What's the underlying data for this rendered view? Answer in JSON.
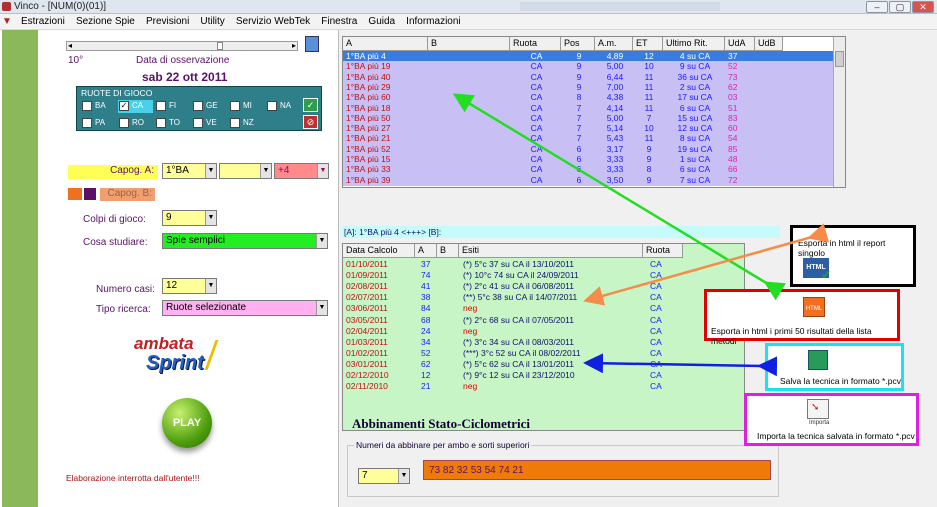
{
  "window": {
    "title": "Vinco - [NUM(0)(01)]",
    "min": "–",
    "max": "▢",
    "close": "✕"
  },
  "menu": [
    "Estrazioni",
    "Sezione Spie",
    "Previsioni",
    "Utility",
    "Servizio WebTek",
    "Finestra",
    "Guida",
    "Informazioni"
  ],
  "left": {
    "num": "10°",
    "obs_label": "Data di osservazione",
    "obs_date": "sab 22 ott 2011",
    "ruote_title": "RUOTE DI GIOCO",
    "ruote_row1": [
      "BA",
      "CA",
      "FI",
      "GE",
      "MI",
      "NA"
    ],
    "ruote_row2": [
      "PA",
      "RO",
      "TO",
      "VE",
      "NZ"
    ],
    "capog_a_label": "Capog. A:",
    "capog_a_val": "1°BA",
    "capog_a_mod": "+4",
    "capog_b_label": "Capog. B:",
    "colpi_label": "Colpi di gioco:",
    "colpi_val": "9",
    "studiare_label": "Cosa studiare:",
    "studiare_val": "Spie semplici",
    "casi_label": "Numero casi:",
    "casi_val": "12",
    "tipo_label": "Tipo ricerca:",
    "tipo_val": "Ruote selezionate",
    "logo1": "ambata",
    "logo2": "Sprint",
    "play": "PLAY",
    "status": "Elaborazione interrotta dall'utente!!!"
  },
  "grid1": {
    "headers": [
      "A",
      "B",
      "Ruota",
      "Pos",
      "A.m.",
      "ET",
      "Ultimo Rit.",
      "UdA",
      "UdB"
    ],
    "rows": [
      [
        "1°BA  più 4",
        "",
        "CA",
        "9",
        "4,89",
        "12",
        "4 su CA",
        "37",
        ""
      ],
      [
        "1°BA  più 19",
        "",
        "CA",
        "9",
        "5,00",
        "10",
        "9 su CA",
        "52",
        ""
      ],
      [
        "1°BA  più 40",
        "",
        "CA",
        "9",
        "6,44",
        "11",
        "36 su CA",
        "73",
        ""
      ],
      [
        "1°BA  più 29",
        "",
        "CA",
        "9",
        "7,00",
        "11",
        "2 su CA",
        "62",
        ""
      ],
      [
        "1°BA  più 60",
        "",
        "CA",
        "8",
        "4,38",
        "11",
        "17 su CA",
        "03",
        ""
      ],
      [
        "1°BA  più 18",
        "",
        "CA",
        "7",
        "4,14",
        "11",
        "6 su CA",
        "51",
        ""
      ],
      [
        "1°BA  più 50",
        "",
        "CA",
        "7",
        "5,00",
        "7",
        "15 su CA",
        "83",
        ""
      ],
      [
        "1°BA  più 27",
        "",
        "CA",
        "7",
        "5,14",
        "10",
        "12 su CA",
        "60",
        ""
      ],
      [
        "1°BA  più 21",
        "",
        "CA",
        "7",
        "5,43",
        "11",
        "8 su CA",
        "54",
        ""
      ],
      [
        "1°BA  più 52",
        "",
        "CA",
        "6",
        "3,17",
        "9",
        "19 su CA",
        "85",
        ""
      ],
      [
        "1°BA  più 15",
        "",
        "CA",
        "6",
        "3,33",
        "9",
        "1 su CA",
        "48",
        ""
      ],
      [
        "1°BA  più 33",
        "",
        "CA",
        "6",
        "3,33",
        "8",
        "6 su CA",
        "66",
        ""
      ],
      [
        "1°BA  più 39",
        "",
        "CA",
        "6",
        "3,50",
        "9",
        "7 su CA",
        "72",
        ""
      ]
    ]
  },
  "abinfo": "[A]: 1°BA  più 4 <+++> [B]:",
  "grid2": {
    "headers": [
      "Data Calcolo",
      "A",
      "B",
      "Esiti",
      "Ruota"
    ],
    "rows": [
      [
        "01/10/2011",
        "37",
        "",
        "(*) 5°c 37 su CA il 13/10/2011",
        "CA"
      ],
      [
        "01/09/2011",
        "74",
        "",
        "(*) 10°c 74 su CA il 24/09/2011",
        "CA"
      ],
      [
        "02/08/2011",
        "41",
        "",
        "(*) 2°c 41 su CA il 06/08/2011",
        "CA"
      ],
      [
        "02/07/2011",
        "38",
        "",
        "(**) 5°c 38 su CA il 14/07/2011",
        "CA"
      ],
      [
        "03/06/2011",
        "84",
        "",
        "neg",
        "CA"
      ],
      [
        "03/05/2011",
        "68",
        "",
        "(*) 2°c 68 su CA il 07/05/2011",
        "CA"
      ],
      [
        "02/04/2011",
        "24",
        "",
        "neg",
        "CA"
      ],
      [
        "01/03/2011",
        "34",
        "",
        "(*) 3°c 34 su CA il 08/03/2011",
        "CA"
      ],
      [
        "01/02/2011",
        "52",
        "",
        "(***) 3°c 52 su CA il 08/02/2011",
        "CA"
      ],
      [
        "03/01/2011",
        "62",
        "",
        "(*) 5°c 62 su CA il 13/01/2011",
        "CA"
      ],
      [
        "02/12/2010",
        "12",
        "",
        "(*) 9°c 12 su CA il 23/12/2010",
        "CA"
      ],
      [
        "02/11/2010",
        "21",
        "",
        "neg",
        "CA"
      ]
    ],
    "footer": "Abbinamenti Stato-Ciclometrici"
  },
  "abbinare": {
    "legend": "Numeri da abbinare per ambo e sorti superiori",
    "combo": "7",
    "numbers": "73 82 32 53 54 74 21"
  },
  "callouts": {
    "html_report": "Esporta in html il report singolo",
    "html_icon": "HTML",
    "html_first50": "Esporta in html i primi 50 risultati della lista metodi",
    "save_tech": "Salva la tecnica in formato *.pcv",
    "import_tech": "Importa la tecnica salvata in formato *.pcv",
    "import_icon_label": "Importa"
  },
  "colors": {
    "black": "#000000",
    "red": "#e00000",
    "cyan": "#1ee0f0",
    "magenta": "#e020e0",
    "green_arrow": "#22dd22",
    "orange_arrow": "#f58c4a",
    "blue_arrow": "#1020e0"
  }
}
